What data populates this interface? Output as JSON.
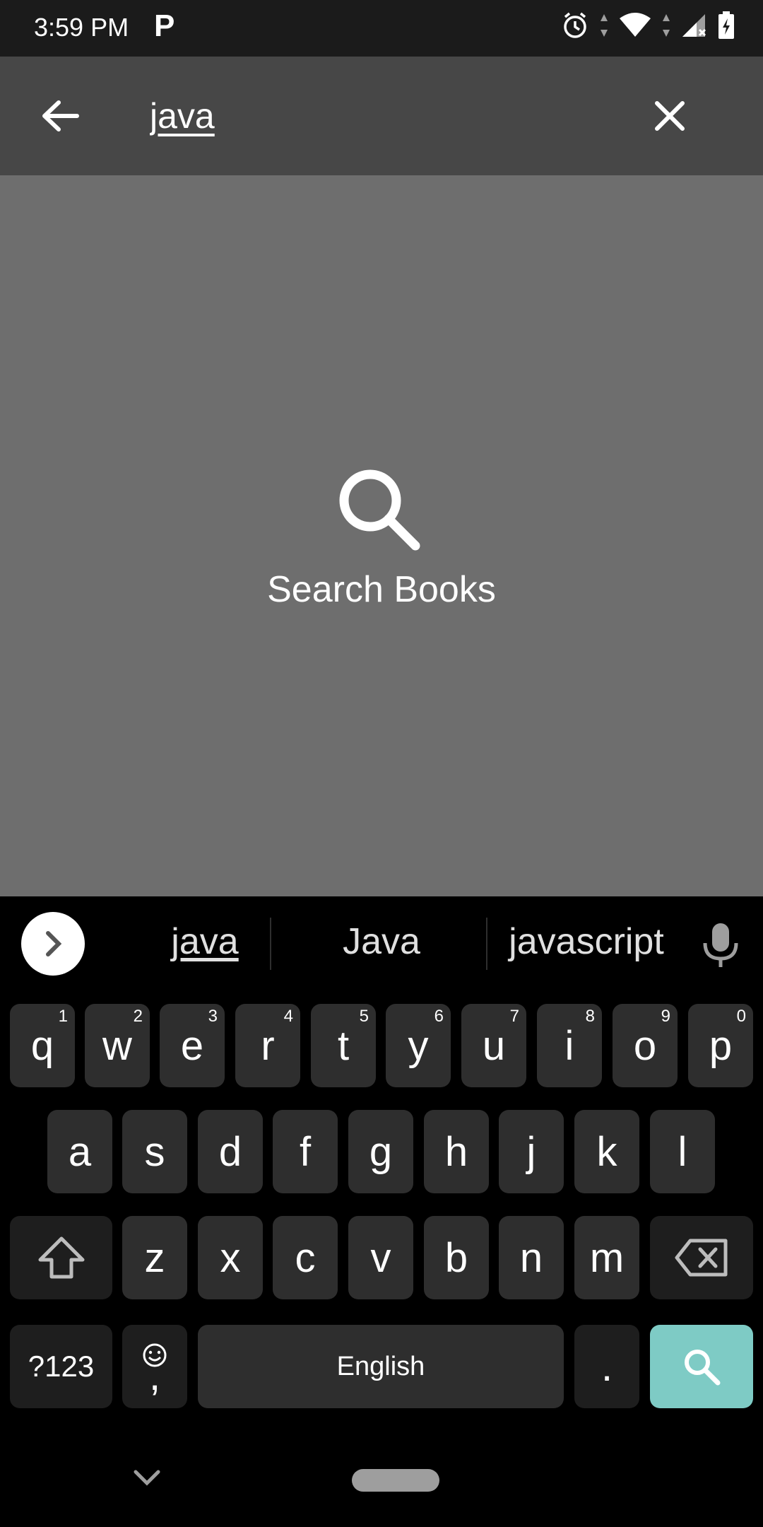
{
  "status_bar": {
    "time": "3:59 PM",
    "notification_icon": "P"
  },
  "search": {
    "query": "java"
  },
  "empty_state": {
    "label": "Search Books"
  },
  "keyboard": {
    "suggestions": [
      "java",
      "Java",
      "javascript"
    ],
    "row1": [
      {
        "key": "q",
        "hint": "1"
      },
      {
        "key": "w",
        "hint": "2"
      },
      {
        "key": "e",
        "hint": "3"
      },
      {
        "key": "r",
        "hint": "4"
      },
      {
        "key": "t",
        "hint": "5"
      },
      {
        "key": "y",
        "hint": "6"
      },
      {
        "key": "u",
        "hint": "7"
      },
      {
        "key": "i",
        "hint": "8"
      },
      {
        "key": "o",
        "hint": "9"
      },
      {
        "key": "p",
        "hint": "0"
      }
    ],
    "row2": [
      "a",
      "s",
      "d",
      "f",
      "g",
      "h",
      "j",
      "k",
      "l"
    ],
    "row3": [
      "z",
      "x",
      "c",
      "v",
      "b",
      "n",
      "m"
    ],
    "symbols_label": "?123",
    "comma_label": ",",
    "space_label": "English",
    "period_label": ".",
    "accent_color": "#7ecbc5"
  }
}
